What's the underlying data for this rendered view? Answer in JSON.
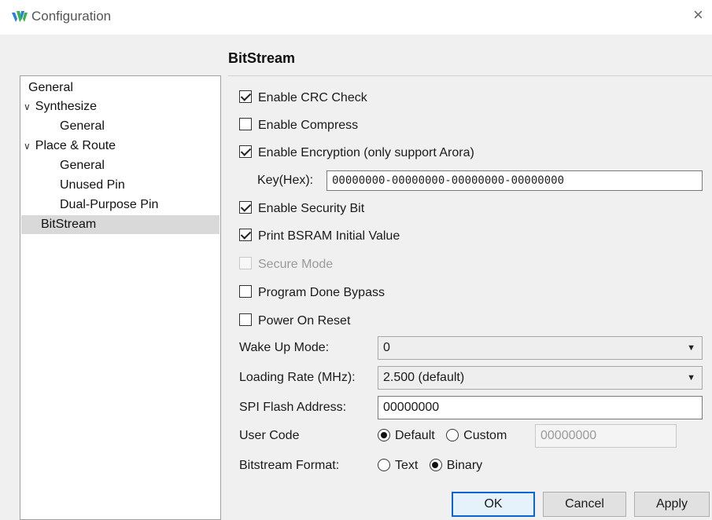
{
  "window": {
    "title": "Configuration",
    "close_glyph": "×",
    "icon": "gowin-logo-icon"
  },
  "page_heading": "BitStream",
  "nav": {
    "items": [
      {
        "label": "General",
        "level": 0
      },
      {
        "label": "Synthesize",
        "level": 0,
        "expanded": true
      },
      {
        "label": "General",
        "level": 1
      },
      {
        "label": "Place & Route",
        "level": 0,
        "expanded": true
      },
      {
        "label": "General",
        "level": 1
      },
      {
        "label": "Unused Pin",
        "level": 1
      },
      {
        "label": "Dual-Purpose Pin",
        "level": 1
      },
      {
        "label": "BitStream",
        "level": 0,
        "selected": true
      }
    ],
    "chevron_glyph": "∨"
  },
  "options": {
    "crc": {
      "label": "Enable CRC Check",
      "checked": true
    },
    "compress": {
      "label": "Enable Compress",
      "checked": false
    },
    "encryption": {
      "label": "Enable Encryption (only support Arora)",
      "checked": true
    },
    "key": {
      "label": "Key(Hex):",
      "value": "00000000-00000000-00000000-00000000"
    },
    "security_bit": {
      "label": "Enable Security Bit",
      "checked": true
    },
    "print_bsram": {
      "label": "Print BSRAM Initial Value",
      "checked": true
    },
    "secure_mode": {
      "label": "Secure Mode",
      "checked": false,
      "disabled": true
    },
    "program_done": {
      "label": "Program Done Bypass",
      "checked": false
    },
    "power_on_reset": {
      "label": "Power On Reset",
      "checked": false
    }
  },
  "form": {
    "wake_up": {
      "label": "Wake Up Mode:",
      "value": "0"
    },
    "loading_rate": {
      "label": "Loading Rate (MHz):",
      "value": "2.500 (default)"
    },
    "spi_flash": {
      "label": "SPI Flash Address:",
      "value": "00000000"
    },
    "user_code": {
      "label": "User Code",
      "opt_default": "Default",
      "opt_custom": "Custom",
      "selected": "Default",
      "custom_value": "00000000"
    },
    "bitstream_format": {
      "label": "Bitstream Format:",
      "opt_text": "Text",
      "opt_binary": "Binary",
      "selected": "Binary"
    },
    "dropdown_arrow": "▼"
  },
  "buttons": {
    "ok": "OK",
    "cancel": "Cancel",
    "apply": "Apply"
  },
  "colors": {
    "accent": "#0a64d4",
    "logo_blue": "#2b7de1",
    "logo_green": "#38b44a"
  }
}
